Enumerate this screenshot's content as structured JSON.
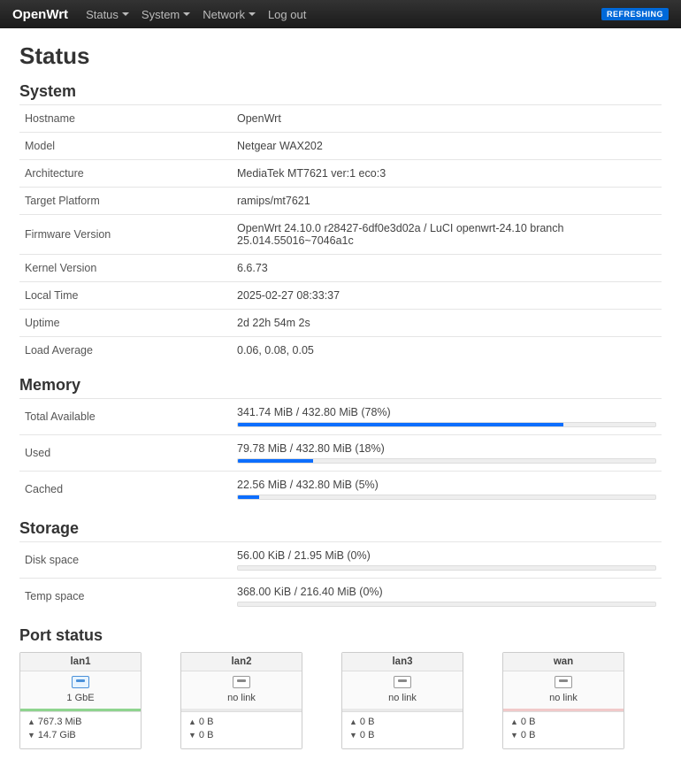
{
  "nav": {
    "brand": "OpenWrt",
    "items": [
      "Status",
      "System",
      "Network",
      "Log out"
    ],
    "badge": "REFRESHING"
  },
  "page": {
    "title": "Status"
  },
  "system": {
    "heading": "System",
    "rows": [
      {
        "label": "Hostname",
        "value": "OpenWrt"
      },
      {
        "label": "Model",
        "value": "Netgear WAX202"
      },
      {
        "label": "Architecture",
        "value": "MediaTek MT7621 ver:1 eco:3"
      },
      {
        "label": "Target Platform",
        "value": "ramips/mt7621"
      },
      {
        "label": "Firmware Version",
        "value": "OpenWrt 24.10.0 r28427-6df0e3d02a / LuCI openwrt-24.10 branch 25.014.55016~7046a1c"
      },
      {
        "label": "Kernel Version",
        "value": "6.6.73"
      },
      {
        "label": "Local Time",
        "value": "2025-02-27 08:33:37"
      },
      {
        "label": "Uptime",
        "value": "2d 22h 54m 2s"
      },
      {
        "label": "Load Average",
        "value": "0.06, 0.08, 0.05"
      }
    ]
  },
  "memory": {
    "heading": "Memory",
    "rows": [
      {
        "label": "Total Available",
        "text": "341.74 MiB / 432.80 MiB (78%)",
        "pct": 78
      },
      {
        "label": "Used",
        "text": "79.78 MiB / 432.80 MiB (18%)",
        "pct": 18
      },
      {
        "label": "Cached",
        "text": "22.56 MiB / 432.80 MiB (5%)",
        "pct": 5
      }
    ]
  },
  "storage": {
    "heading": "Storage",
    "rows": [
      {
        "label": "Disk space",
        "text": "56.00 KiB / 21.95 MiB (0%)",
        "pct": 0
      },
      {
        "label": "Temp space",
        "text": "368.00 KiB / 216.40 MiB (0%)",
        "pct": 0
      }
    ]
  },
  "ports": {
    "heading": "Port status",
    "items": [
      {
        "name": "lan1",
        "speed": "1 GbE",
        "state": "active",
        "up": "767.3 MiB",
        "down": "14.7 GiB"
      },
      {
        "name": "lan2",
        "speed": "no link",
        "state": "nolink",
        "up": "0 B",
        "down": "0 B"
      },
      {
        "name": "lan3",
        "speed": "no link",
        "state": "nolink",
        "up": "0 B",
        "down": "0 B"
      },
      {
        "name": "wan",
        "speed": "no link",
        "state": "wan",
        "up": "0 B",
        "down": "0 B"
      }
    ]
  }
}
